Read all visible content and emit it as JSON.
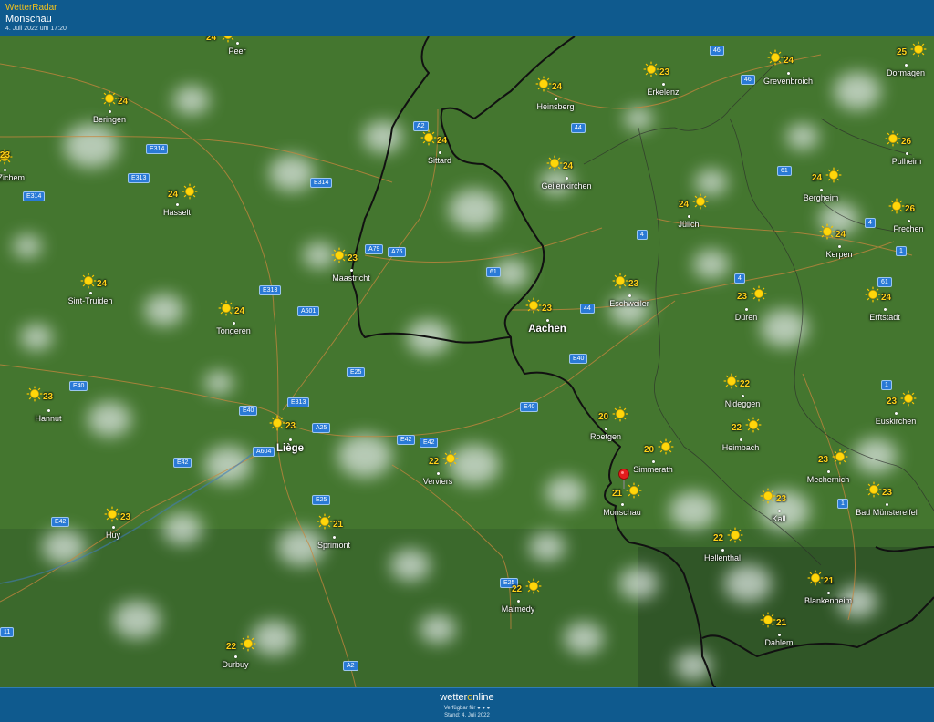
{
  "header": {
    "brand": "WetterRadar",
    "location": "Monschau",
    "timestamp": "4. Juli 2022 um 17:20"
  },
  "footer": {
    "logo_a": "wetter",
    "logo_o": "o",
    "logo_b": "nline",
    "available": "Verfügbar für",
    "status": "Stand: 4. Juli 2022"
  },
  "icons": {
    "weather": "sun-icon",
    "marker": "location-pin-icon"
  },
  "colors": {
    "header": "#0f5a8e",
    "temp": "#ffd21a",
    "border": "#111111",
    "road": "#2a7ad6"
  },
  "cities": [
    {
      "name": "Peer",
      "temp": "24"
    },
    {
      "name": "Beringen",
      "temp": "24"
    },
    {
      "name": "vel-Zichem",
      "temp": "23"
    },
    {
      "name": "Hasselt",
      "temp": "24"
    },
    {
      "name": "Sint-Truiden",
      "temp": "24"
    },
    {
      "name": "Tongeren",
      "temp": "24"
    },
    {
      "name": "Hannut",
      "temp": "23"
    },
    {
      "name": "Huy",
      "temp": "23"
    },
    {
      "name": "Liège",
      "temp": "23"
    },
    {
      "name": "Sprimont",
      "temp": "21"
    },
    {
      "name": "Verviers",
      "temp": "22"
    },
    {
      "name": "Durbuy",
      "temp": "22"
    },
    {
      "name": "Malmedy",
      "temp": "22"
    },
    {
      "name": "Maastricht",
      "temp": "23"
    },
    {
      "name": "Sittard",
      "temp": "24"
    },
    {
      "name": "Heinsberg",
      "temp": "24"
    },
    {
      "name": "Geilenkirchen",
      "temp": "24"
    },
    {
      "name": "Aachen",
      "temp": "23"
    },
    {
      "name": "Erkelenz",
      "temp": "23"
    },
    {
      "name": "Jülich",
      "temp": "24"
    },
    {
      "name": "Eschweiler",
      "temp": "23"
    },
    {
      "name": "Düren",
      "temp": "23"
    },
    {
      "name": "Roetgen",
      "temp": "20"
    },
    {
      "name": "Simmerath",
      "temp": "20"
    },
    {
      "name": "Monschau",
      "temp": "21"
    },
    {
      "name": "Nideggen",
      "temp": "22"
    },
    {
      "name": "Heimbach",
      "temp": "22"
    },
    {
      "name": "Hellenthal",
      "temp": "22"
    },
    {
      "name": "Mechernich",
      "temp": "23"
    },
    {
      "name": "Kall",
      "temp": "23"
    },
    {
      "name": "Blankenheim",
      "temp": "21"
    },
    {
      "name": "Dahlem",
      "temp": "21"
    },
    {
      "name": "Grevenbroich",
      "temp": "24"
    },
    {
      "name": "Dormagen",
      "temp": "25"
    },
    {
      "name": "Pulheim",
      "temp": "26"
    },
    {
      "name": "Bergheim",
      "temp": "24"
    },
    {
      "name": "Kerpen",
      "temp": "24"
    },
    {
      "name": "Frechen",
      "temp": "26"
    },
    {
      "name": "Erftstadt",
      "temp": "24"
    },
    {
      "name": "Euskirchen",
      "temp": "23"
    },
    {
      "name": "Bad Münstereifel",
      "temp": "23"
    }
  ],
  "extra_temps": [
    "23"
  ],
  "roads": [
    "E314",
    "E313",
    "E314",
    "E314",
    "E313",
    "E40",
    "E40",
    "E313",
    "A601",
    "E25",
    "A25",
    "A604",
    "E42",
    "E42",
    "E25",
    "E40",
    "E42",
    "E42",
    "E25",
    "A2",
    "A2",
    "A79",
    "A76",
    "61",
    "46",
    "46",
    "44",
    "4",
    "44",
    "E40",
    "4",
    "61",
    "4",
    "1",
    "61",
    "1",
    "1",
    "11"
  ]
}
